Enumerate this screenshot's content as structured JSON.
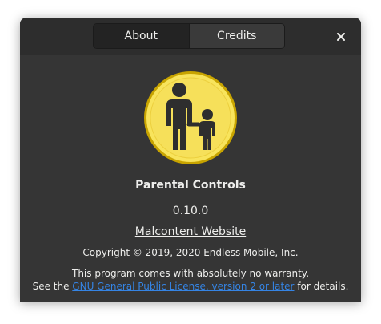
{
  "tabs": {
    "about": "About",
    "credits": "Credits"
  },
  "close_icon": "close-icon",
  "app": {
    "logo_icon": "parental-controls-icon",
    "name": "Parental Controls",
    "version": "0.10.0",
    "website": "Malcontent Website",
    "copyright": "Copyright © 2019, 2020 Endless Mobile, Inc."
  },
  "license": {
    "line1": "This program comes with absolutely no warranty.",
    "prefix": "See the ",
    "link": "GNU General Public License, version 2 or later",
    "suffix": " for details."
  },
  "colors": {
    "dialog_bg": "#353535",
    "accent_link": "#3584e4",
    "logo_fill": "#f8e45c"
  }
}
